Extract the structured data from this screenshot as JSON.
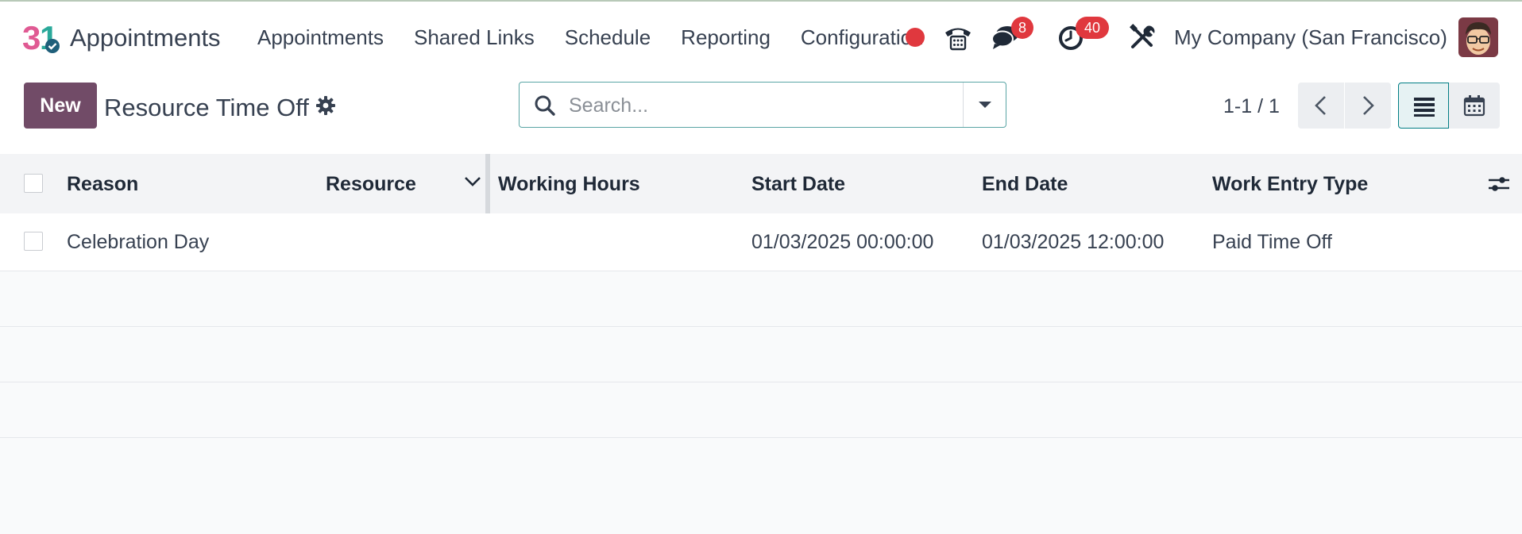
{
  "navbar": {
    "app_name": "Appointments",
    "menu": [
      "Appointments",
      "Shared Links",
      "Schedule",
      "Reporting",
      "Configuration"
    ],
    "messages_badge": "8",
    "activities_badge": "40",
    "company": "My Company (San Francisco)"
  },
  "control_panel": {
    "new_label": "New",
    "title": "Resource Time Off",
    "search_placeholder": "Search...",
    "pager": "1-1 / 1"
  },
  "table": {
    "columns": [
      "Reason",
      "Resource",
      "Working Hours",
      "Start Date",
      "End Date",
      "Work Entry Type"
    ],
    "rows": [
      {
        "reason": "Celebration Day",
        "resource": "",
        "working_hours": "",
        "start_date": "01/03/2025 00:00:00",
        "end_date": "01/03/2025 12:00:00",
        "work_entry_type": "Paid Time Off"
      }
    ]
  },
  "colors": {
    "primary": "#714b67",
    "badge": "#e0383e",
    "accent": "#017e84"
  },
  "icons": [
    "phone-icon",
    "chat-icon",
    "clock-icon",
    "tools-icon",
    "gear-icon",
    "search-icon",
    "list-view-icon",
    "calendar-view-icon",
    "column-settings-icon"
  ]
}
